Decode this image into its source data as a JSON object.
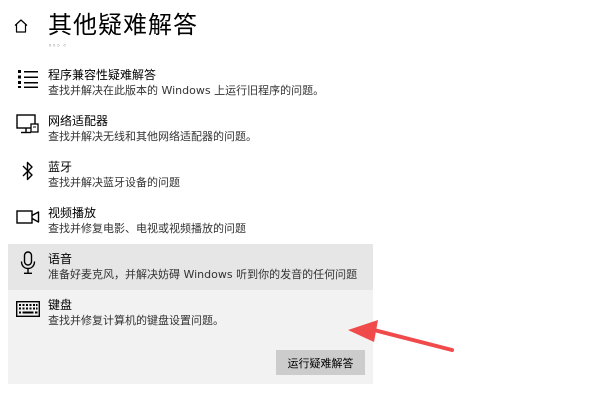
{
  "page": {
    "title": "其他疑难解答",
    "sub_mark": "◦◦◦ ◦"
  },
  "items": [
    {
      "icon": "list-icon",
      "title": "程序兼容性疑难解答",
      "desc": "查找并解决在此版本的 Windows 上运行旧程序的问题。"
    },
    {
      "icon": "monitor-network-icon",
      "title": "网络适配器",
      "desc": "查找并解决无线和其他网络适配器的问题。"
    },
    {
      "icon": "bluetooth-icon",
      "title": "蓝牙",
      "desc": "查找并解决蓝牙设备的问题"
    },
    {
      "icon": "video-camera-icon",
      "title": "视频播放",
      "desc": "查找并修复电影、电视或视频播放的问题"
    },
    {
      "icon": "microphone-icon",
      "title": "语音",
      "desc": "准备好麦克风，并解决妨碍 Windows 听到你的发音的任何问题"
    },
    {
      "icon": "keyboard-icon",
      "title": "键盘",
      "desc": "查找并修复计算机的键盘设置问题。"
    }
  ],
  "run_button": {
    "label": "运行疑难解答"
  },
  "colors": {
    "hover_bg": "#e6e6e6",
    "selected_bg": "#f2f2f2",
    "button_bg": "#cccccc",
    "arrow": "#f04a4a"
  }
}
